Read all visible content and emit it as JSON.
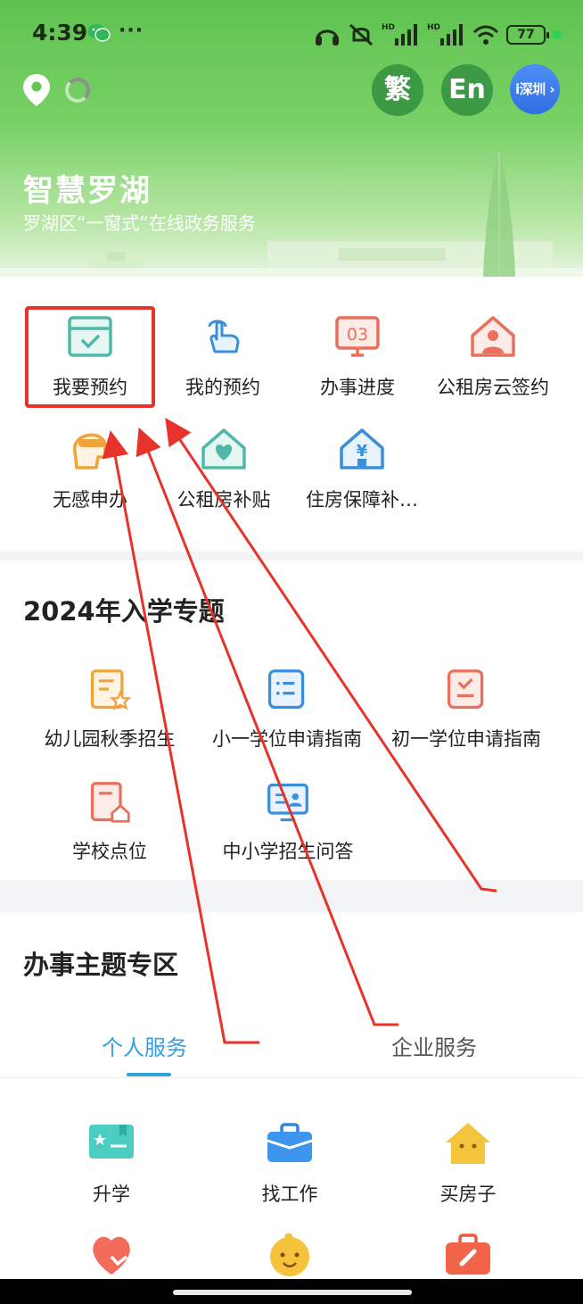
{
  "status_bar": {
    "time": "4:39",
    "dots": "···",
    "battery": "77",
    "hd1": "HD",
    "hd2": "HD"
  },
  "header": {
    "traditional_label": "繁",
    "english_label": "En",
    "city_label": "i深圳 ›",
    "title": "智慧罗湖",
    "subtitle": "罗湖区“一窗式”在线政务服务"
  },
  "quick_services": [
    {
      "label": "我要预约",
      "icon": "calendar-check-icon"
    },
    {
      "label": "我的预约",
      "icon": "touch-hand-icon"
    },
    {
      "label": "办事进度",
      "icon": "monitor-03-icon"
    },
    {
      "label": "公租房云签约",
      "icon": "house-person-icon"
    },
    {
      "label": "无感申办",
      "icon": "face-scan-icon"
    },
    {
      "label": "公租房补贴",
      "icon": "house-heart-icon"
    },
    {
      "label": "住房保障补…",
      "icon": "house-yen-icon"
    }
  ],
  "enrollment": {
    "title": "2024年入学专题",
    "items": [
      {
        "label": "幼儿园秋季招生",
        "icon": "document-star-icon"
      },
      {
        "label": "小一学位申请指南",
        "icon": "document-list-icon"
      },
      {
        "label": "初一学位申请指南",
        "icon": "document-check-icon"
      },
      {
        "label": "学校点位",
        "icon": "document-house-icon"
      },
      {
        "label": "中小学招生问答",
        "icon": "board-person-icon"
      }
    ]
  },
  "themes": {
    "title": "办事主题专区",
    "tabs": [
      "个人服务",
      "企业服务"
    ],
    "active_tab": "个人服务",
    "items": [
      {
        "label": "升学",
        "icon": "diploma-icon"
      },
      {
        "label": "找工作",
        "icon": "briefcase-icon"
      },
      {
        "label": "买房子",
        "icon": "house-icon"
      },
      {
        "label": "",
        "icon": "heart-hands-icon"
      },
      {
        "label": "",
        "icon": "baby-face-icon"
      },
      {
        "label": "",
        "icon": "medical-kit-icon"
      }
    ]
  },
  "colors": {
    "accent_blue": "#33a0e0",
    "highlight_red": "#e8332a",
    "header_green": "#5ec350"
  }
}
